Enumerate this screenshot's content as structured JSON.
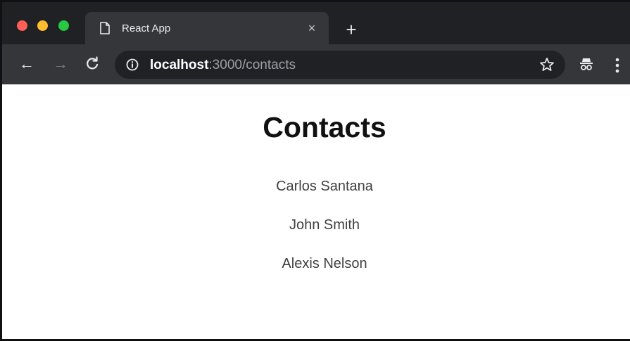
{
  "browser": {
    "tab": {
      "title": "React App",
      "close_glyph": "×",
      "icon": "document-icon"
    },
    "new_tab_glyph": "+",
    "nav": {
      "back_glyph": "←",
      "forward_glyph": "→",
      "reload_glyph": "C"
    },
    "address": {
      "host": "localhost",
      "rest": ":3000/contacts"
    },
    "icons": [
      "info-icon",
      "star-icon",
      "incognito-icon",
      "menu-icon"
    ],
    "colors": {
      "tabstrip": "#202124",
      "toolbar": "#35363a",
      "close": "#ff5f57",
      "minimize": "#febc2e",
      "zoom": "#28c840"
    }
  },
  "page": {
    "title": "Contacts",
    "contacts": [
      {
        "name": "Carlos Santana"
      },
      {
        "name": "John Smith"
      },
      {
        "name": "Alexis Nelson"
      }
    ]
  }
}
